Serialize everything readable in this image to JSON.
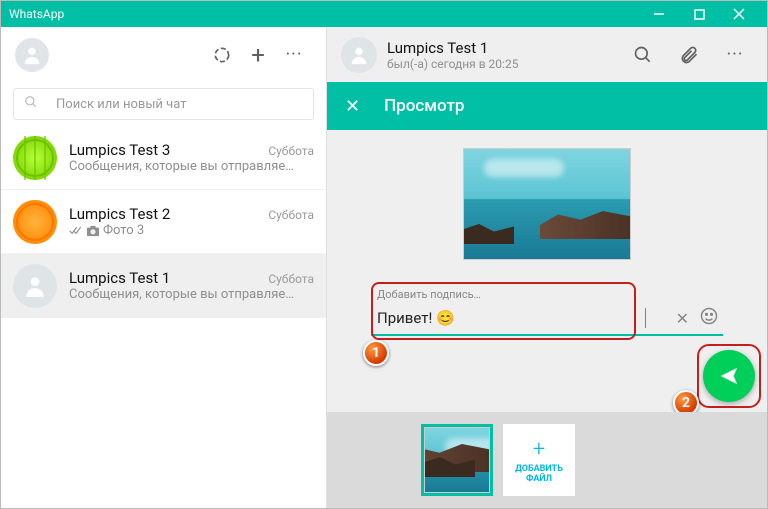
{
  "titlebar": {
    "title": "WhatsApp"
  },
  "search": {
    "placeholder": "Поиск или новый чат"
  },
  "chats": [
    {
      "name": "Lumpics Test 3",
      "time": "Суббота",
      "msg": "Сообщения, которые вы отправляе…",
      "avatar": "lime"
    },
    {
      "name": "Lumpics Test 2",
      "time": "Суббота",
      "msg": "Фото 3",
      "avatar": "orange",
      "checks": true,
      "photo_icon": true
    },
    {
      "name": "Lumpics Test 1",
      "time": "Суббота",
      "msg": "Сообщения, которые вы отправляе…",
      "avatar": "blank",
      "selected": true
    }
  ],
  "active_chat": {
    "name": "Lumpics Test 1",
    "status": "был(-а) сегодня в 20:25"
  },
  "preview": {
    "title": "Просмотр",
    "caption_label": "Добавить подпись…",
    "caption_text": "Привет! 😊",
    "add_file_label": "ДОБАВИТЬ ФАЙЛ"
  },
  "markers": {
    "m1": "1",
    "m2": "2"
  }
}
